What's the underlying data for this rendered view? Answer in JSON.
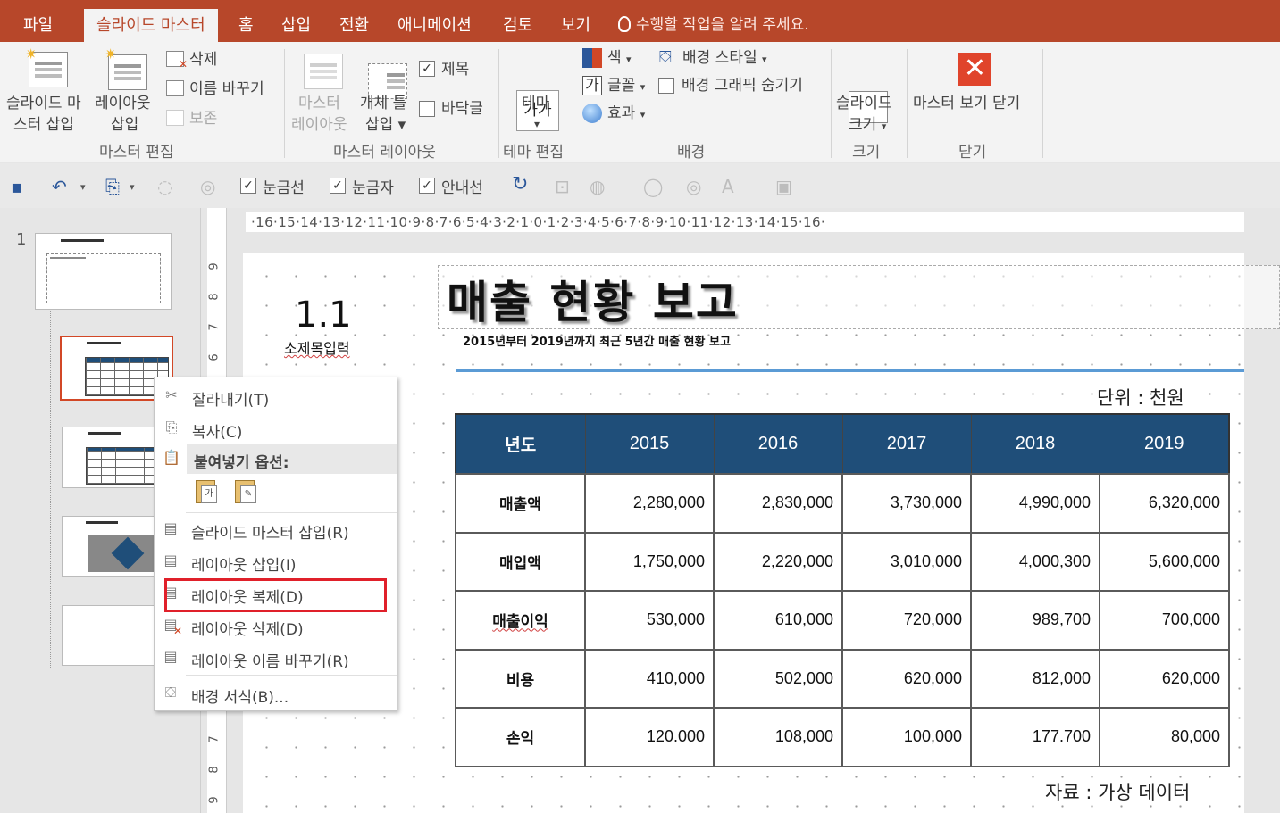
{
  "tabs": {
    "file": "파일",
    "slide_master": "슬라이드 마스터",
    "home": "홈",
    "insert": "삽입",
    "transitions": "전환",
    "animations": "애니메이션",
    "review": "검토",
    "view": "보기",
    "tell_me": "수행할 작업을 알려 주세요."
  },
  "ribbon": {
    "insert_slide_master": [
      "슬라이드 마",
      "스터 삽입"
    ],
    "insert_layout": [
      "레이아웃",
      "삽입"
    ],
    "delete": "삭제",
    "rename": "이름 바꾸기",
    "preserve": "보존",
    "group_master_edit": "마스터 편집",
    "master_layout": [
      "마스터",
      "레이아웃"
    ],
    "insert_placeholder": [
      "개체 틀",
      "삽입"
    ],
    "title_chk": "제목",
    "footer_chk": "바닥글",
    "group_master_layout": "마스터 레이아웃",
    "theme_icon": "가가",
    "theme": "테마",
    "group_edit_theme": "테마 편집",
    "colors": "색",
    "fonts": "글꼴",
    "effects": "효과",
    "bg_styles": "배경 스타일",
    "hide_bg": "배경 그래픽 숨기기",
    "group_background": "배경",
    "slide_size": [
      "슬라이드",
      "크기"
    ],
    "group_size": "크기",
    "close_master": "마스터 보기 닫기",
    "group_close": "닫기"
  },
  "qat": {
    "gridlines": "눈금선",
    "ruler": "눈금자",
    "guides": "안내선"
  },
  "thumbs": {
    "slide_number": "1"
  },
  "hruler": "·16·15·14·13·12·11·10·9·8·7·6·5·4·3·2·1·0·1·2·3·4·5·6·7·8·9·10·11·12·13·14·15·16·",
  "vruler": [
    "9",
    "8",
    "7",
    "6",
    "7",
    "8",
    "9"
  ],
  "slide": {
    "title": "매출 현황 보고",
    "subtitle": "2015년부터 2019년까지 최근 5년간 매출 현황 보고",
    "section_num": "1.1",
    "section_title": "소제목입력",
    "unit": "단위 : 천원",
    "source": "자료 : 가상 데이터"
  },
  "table": {
    "headers": [
      "년도",
      "2015",
      "2016",
      "2017",
      "2018",
      "2019"
    ],
    "rows": [
      [
        "매출액",
        "2,280,000",
        "2,830,000",
        "3,730,000",
        "4,990,000",
        "6,320,000"
      ],
      [
        "매입액",
        "1,750,000",
        "2,220,000",
        "3,010,000",
        "4,000,300",
        "5,600,000"
      ],
      [
        "매출이익",
        "530,000",
        "610,000",
        "720,000",
        "989,700",
        "700,000"
      ],
      [
        "비용",
        "410,000",
        "502,000",
        "620,000",
        "812,000",
        "620,000"
      ],
      [
        "손익",
        "120.000",
        "108,000",
        "100,000",
        "177.700",
        "80,000"
      ]
    ]
  },
  "context_menu": {
    "cut": "잘라내기(T)",
    "copy": "복사(C)",
    "paste_options": "붙여넣기 옵션:",
    "insert_slide_master": "슬라이드 마스터 삽입(R)",
    "insert_layout": "레이아웃 삽입(I)",
    "duplicate_layout": "레이아웃 복제(D)",
    "delete_layout": "레이아웃 삭제(D)",
    "rename_layout": "레이아웃 이름 바꾸기(R)",
    "format_background": "배경 서식(B)..."
  },
  "colors": {
    "accent": "#b7472a",
    "table_header": "#1f4e79",
    "highlight": "#e0202a"
  }
}
